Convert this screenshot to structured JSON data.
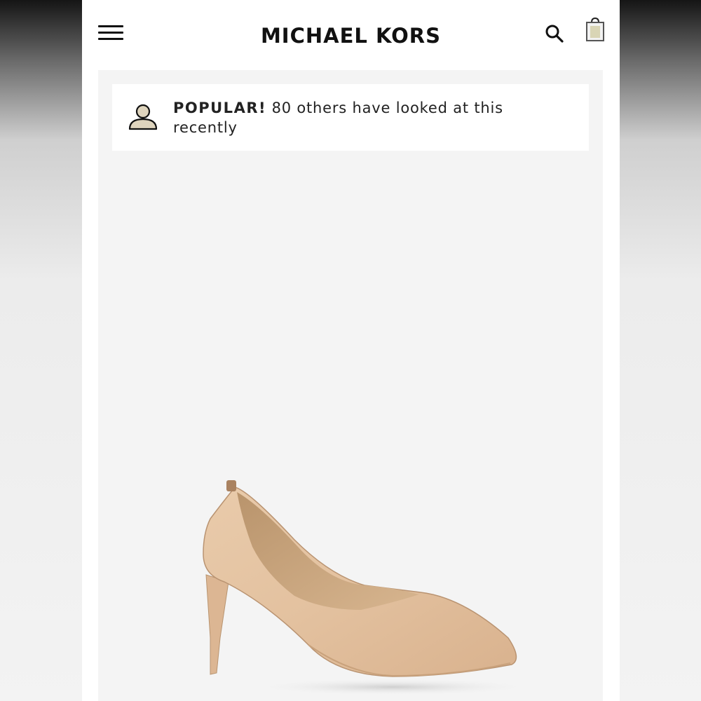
{
  "header": {
    "brand": "MICHAEL KORS",
    "menu_icon": "hamburger-menu-icon",
    "search_icon": "search-icon",
    "bag_icon": "shopping-bag-icon"
  },
  "popular_banner": {
    "label": "POPULAR!",
    "message": "80 others have looked at this recently",
    "icon": "person-icon"
  },
  "product": {
    "image": "nude-leather-pump-image"
  },
  "colors": {
    "background": "#ffffff",
    "product_bg": "#f4f4f4",
    "text": "#111111",
    "icon_fill": "#d8ccb0",
    "shoe": "#e2c2a0"
  }
}
